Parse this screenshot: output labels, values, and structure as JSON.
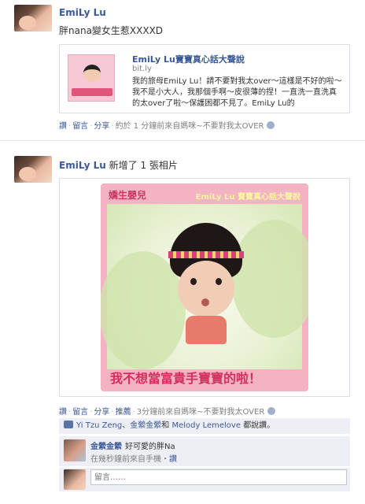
{
  "post1": {
    "author": "EmiLy Lu",
    "status": "胖nana變女生惹XXXXD",
    "share": {
      "title": "EmiLy Lu寶寶真心話大聲說",
      "domain": "bit.ly",
      "description": "我的旅母EmiLy Lu！請不要對我太over～這樣是不好的啦～我不是小大人，我那個手啊～皮很薄的捏！一直洗一直洗真的太over了啦～保護困都不見了。EmiLy Lu的"
    },
    "actions": {
      "read": "讚",
      "comment": "留言",
      "share": "分享",
      "meta": "約於 1 分鐘前來自媽咪~不要對我太OVER"
    }
  },
  "post2": {
    "author": "EmiLy Lu",
    "status": "新增了 1 張相片",
    "photo": {
      "logo": "嬌生嬰兒",
      "title": "EmiLy Lu 寶寶真心話大聲說",
      "caption": "我不想當富貴手寶寶的啦！"
    },
    "actions": {
      "read": "讚",
      "comment": "留言",
      "share": "分享",
      "recommend": "推薦",
      "meta": "3分鐘前來自媽咪~不要對我太OVER"
    },
    "likes": {
      "names": [
        "Yi Tzu Zeng",
        "金縈金縈",
        "Melody Lemelove"
      ],
      "sep1": "、",
      "and": "和",
      "suffix": "都說讚。"
    },
    "comment": {
      "author": "金縈金縈",
      "text": "好可愛的胖Na",
      "time": "在幾秒鐘前來自手機・",
      "like": "讚"
    },
    "reply_placeholder": "留言……"
  }
}
